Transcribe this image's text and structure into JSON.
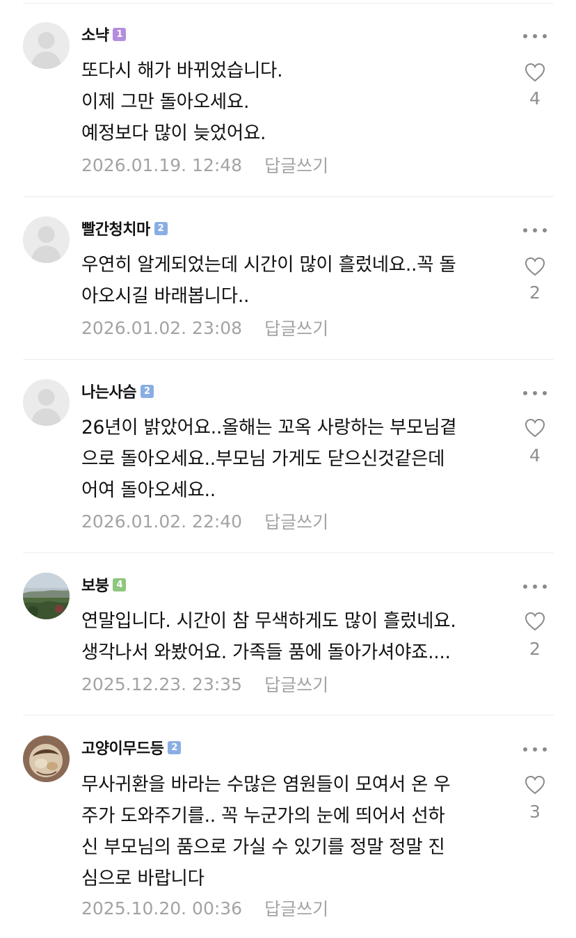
{
  "reply_label": "답글쓰기",
  "colors": {
    "badge_level1": "#b48ddc",
    "badge_level2": "#8aaee4",
    "badge_level4": "#8fc57f",
    "meta_text": "#a3a3a3",
    "like_count": "#8e8e8e"
  },
  "comments": [
    {
      "author": "소냑",
      "level": "1",
      "avatar": "default-profile-icon",
      "text": "또다시 해가 바뀌었습니다.\n이제 그만 돌아오세요.\n예정보다 많이 늦었어요.",
      "date": "2026.01.19. 12:48",
      "likes": "4"
    },
    {
      "author": "빨간청치마",
      "level": "2",
      "avatar": "default-profile-icon",
      "text": "우연히 알게되었는데 시간이 많이 흘렀네요..꼭 돌\n아오시길 바래봅니다..",
      "date": "2026.01.02. 23:08",
      "likes": "2"
    },
    {
      "author": "나는사슴",
      "level": "2",
      "avatar": "default-profile-icon",
      "text": "26년이 밝았어요..올해는 꼬옥 사랑하는 부모님곁\n으로 돌아오세요..부모님 가게도 닫으신것같은데\n어여 돌아오세요..",
      "date": "2026.01.02. 22:40",
      "likes": "4"
    },
    {
      "author": "보붕",
      "level": "4",
      "avatar": "landscape-photo-avatar",
      "text": "연말입니다. 시간이 참 무색하게도 많이 흘렀네요.\n생각나서 와봤어요. 가족들 품에 돌아가셔야죠....",
      "date": "2025.12.23. 23:35",
      "likes": "2"
    },
    {
      "author": "고양이무드등",
      "level": "2",
      "avatar": "illustration-avatar",
      "text": "무사귀환을 바라는 수많은 염원들이 모여서 온 우\n주가 도와주기를.. 꼭 누군가의 눈에 띄어서 선하\n신 부모님의 품으로 가실 수 있기를 정말 정말 진\n심으로 바랍니다",
      "date": "2025.10.20. 00:36",
      "likes": "3"
    }
  ]
}
